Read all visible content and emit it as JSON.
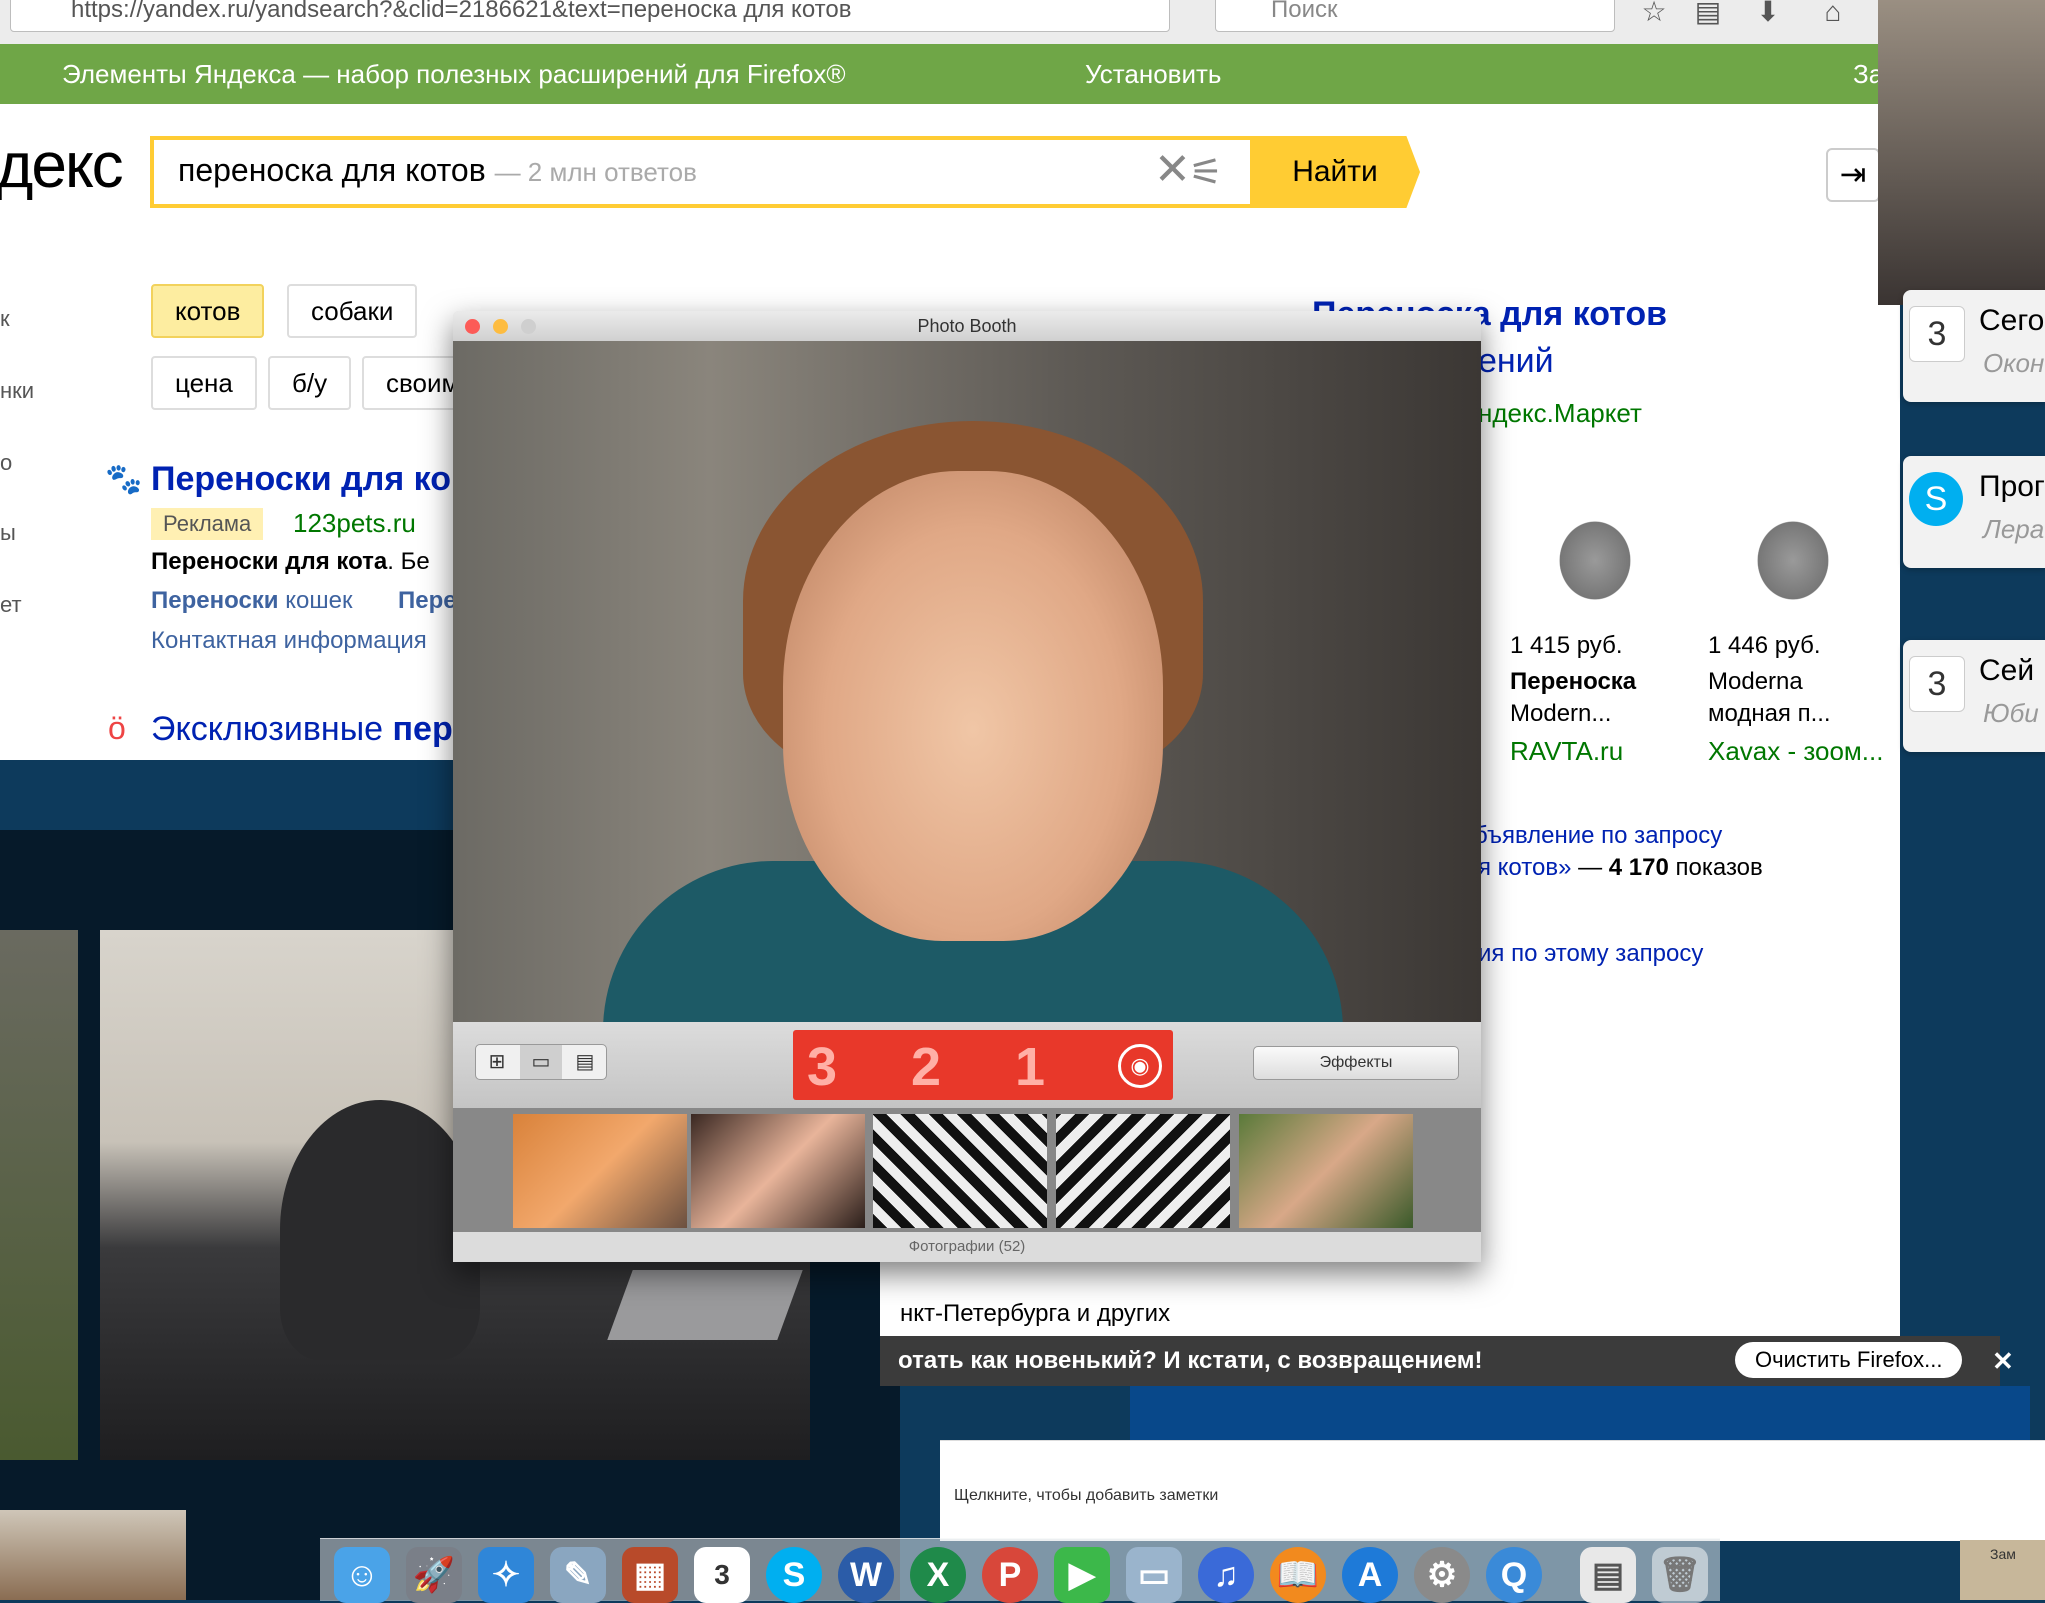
{
  "browser": {
    "url": "https://yandex.ru/yandsearch?&clid=2186621&text=переноска для котов",
    "search_placeholder": "Поиск",
    "ext_bar": {
      "text": "Элементы Яндекса — набор полезных расширений для Firefox®",
      "install": "Установить",
      "close_partial": "За"
    },
    "logo": "декс",
    "query": "переноска для котов",
    "result_count": "— 2 млн ответов",
    "find_button": "Найти",
    "chips": [
      "котов",
      "собаки",
      "цена",
      "б/у",
      "своим"
    ],
    "left_side": [
      "к",
      "нки",
      "о",
      "ы",
      "ет"
    ],
    "result1": {
      "title": "Переноски для ко",
      "ad": "Реклама",
      "domain": "123pets.ru",
      "snippet_bold": "Переноски для кота",
      "snippet_rest": ". Бе",
      "link1_bold": "Переноски",
      "link1_rest": " кошек",
      "link2": "Пере",
      "contact": "Контактная информация"
    },
    "result2": {
      "title_a": "Эксклюзивные ",
      "title_b": "пер"
    },
    "market": {
      "title": "Переноска для котов",
      "subtitle": "ений",
      "source": "ндекс.Маркет"
    },
    "products": [
      {
        "price": "1 415 руб.",
        "name": "Переноска",
        "desc": "Modern...",
        "shop": "RAVTA.ru"
      },
      {
        "price": "1 446 руб.",
        "name": "Moderna",
        "desc": "модная п...",
        "shop": "Xavax - зоом..."
      }
    ],
    "ad_query_1": "бъявление по запросу",
    "ad_query_2": "я котов»",
    "ad_query_count": "4 170",
    "ad_query_shows": "показов",
    "ad_query_3": "ия по этому запросу",
    "spb": "нкт-Петербурга и других",
    "notification": {
      "text": "отать как новенький? И кстати, с возвращением!",
      "button": "Очистить Firefox...",
      "close": "✕"
    }
  },
  "notes": {
    "placeholder": "Щелкните, чтобы добавить заметки"
  },
  "widgets": [
    {
      "icon": "3",
      "t1": "Сего",
      "t2": "Окон"
    },
    {
      "icon": "S",
      "t1": "Прог",
      "t2": "Лера"
    },
    {
      "icon": "3",
      "t1": "Сей",
      "t2": "Юби"
    }
  ],
  "photobooth": {
    "title": "Photo Booth",
    "countdown": [
      "3",
      "2",
      "1"
    ],
    "effects": "Эффекты",
    "footer": "Фотографии (52)"
  },
  "dock": {
    "calendar_day": "3",
    "menubar_right": "Зам"
  },
  "colors": {
    "yandex_yellow": "#ffcc33",
    "ext_green": "#6fa647",
    "countdown_red": "#e8382a",
    "link_blue": "#0022b2"
  }
}
